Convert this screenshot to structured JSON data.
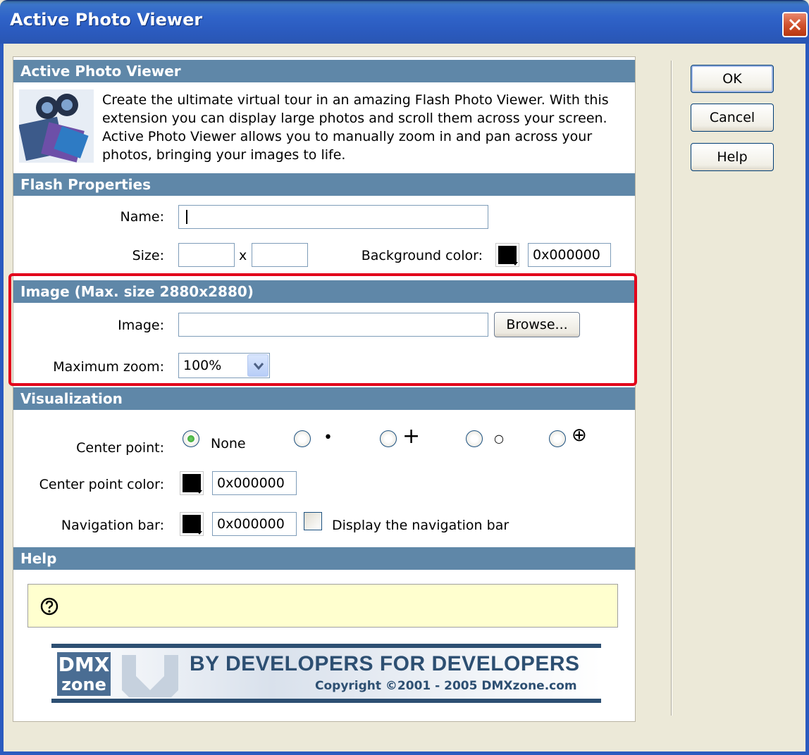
{
  "window": {
    "title": "Active Photo Viewer"
  },
  "intro": {
    "heading": "Active Photo Viewer",
    "lines": [
      "Create the ultimate virtual tour in an amazing Flash Photo Viewer. With this",
      "extension you can display large photos and scroll them across your screen.",
      "Active Photo Viewer allows you to manually zoom in and pan across your",
      "photos, bringing your images to life."
    ]
  },
  "flash": {
    "heading": "Flash Properties",
    "name_label": "Name:",
    "name_value": "",
    "size_label": "Size:",
    "width_value": "",
    "size_sep": "x",
    "height_value": "",
    "bg_label": "Background color:",
    "bg_value": "0x000000"
  },
  "image": {
    "heading": "Image (Max. size 2880x2880)",
    "image_label": "Image:",
    "image_value": "",
    "browse_label": "Browse...",
    "zoom_label": "Maximum zoom:",
    "zoom_value": "100%"
  },
  "visualization": {
    "heading": "Visualization",
    "center_label": "Center point:",
    "center_options": [
      "None",
      "•",
      "+",
      "○",
      "⊕"
    ],
    "center_selected": "None",
    "cp_color_label": "Center point color:",
    "cp_color_value": "0x000000",
    "nav_label": "Navigation bar:",
    "nav_color_value": "0x000000",
    "nav_checkbox_label": "Display the navigation bar",
    "nav_checked": false
  },
  "help": {
    "heading": "Help",
    "text": ""
  },
  "banner": {
    "logo_top": "DMX",
    "logo_bottom": "zone",
    "slogan": "BY DEVELOPERS FOR DEVELOPERS",
    "copyright": "Copyright ©2001 - 2005 DMXzone.com"
  },
  "buttons": {
    "ok": "OK",
    "cancel": "Cancel",
    "help": "Help"
  }
}
